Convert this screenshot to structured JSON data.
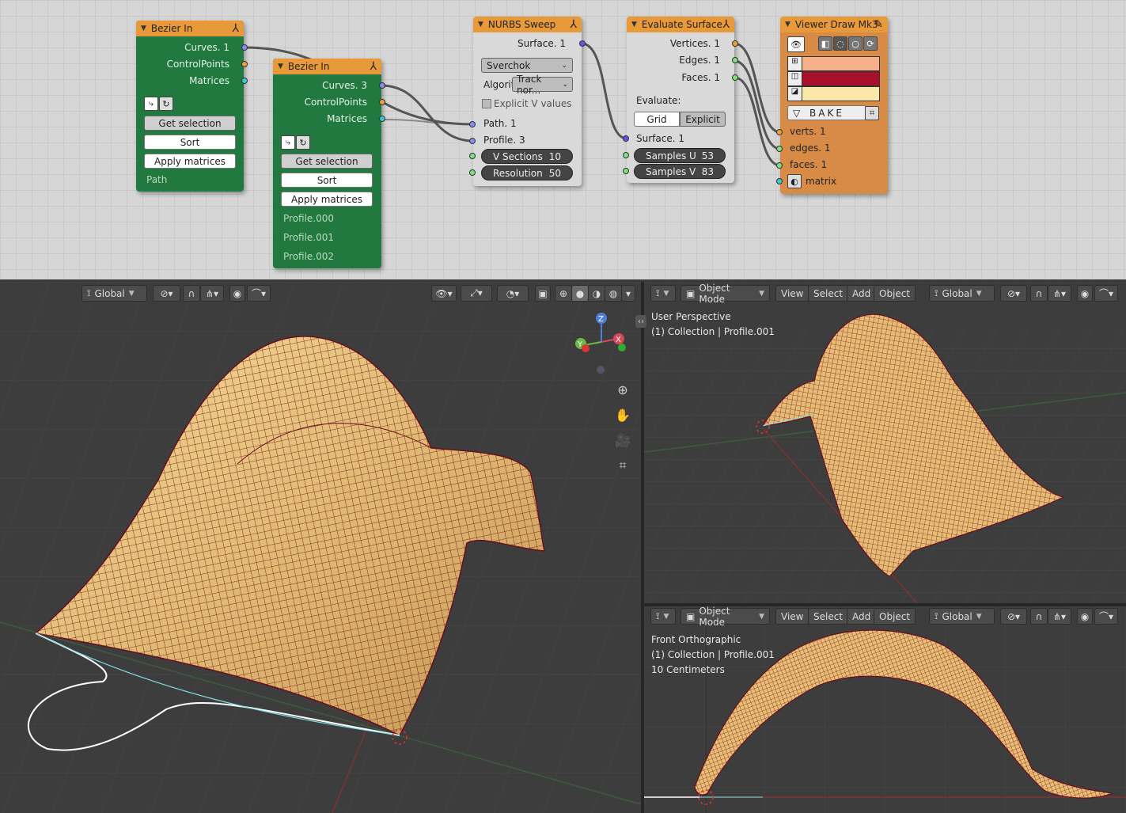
{
  "node_editor": {
    "bezier_in_1": {
      "title": "Bezier In",
      "outputs": [
        "Curves. 1",
        "ControlPoints",
        "Matrices"
      ],
      "get_selection": "Get selection",
      "sort": "Sort",
      "apply_matrices": "Apply matrices",
      "objects": [
        "Path"
      ]
    },
    "bezier_in_2": {
      "title": "Bezier In",
      "outputs": [
        "Curves. 3",
        "ControlPoints",
        "Matrices"
      ],
      "get_selection": "Get selection",
      "sort": "Sort",
      "apply_matrices": "Apply matrices",
      "objects": [
        "Profile.000",
        "Profile.001",
        "Profile.002"
      ]
    },
    "nurbs_sweep": {
      "title": "NURBS Sweep",
      "output": "Surface. 1",
      "implementation": "Sverchok",
      "algorithm_label": "Algorit",
      "algorithm_value": "Track nor...",
      "explicit_v": "Explicit V values",
      "inputs": [
        "Path. 1",
        "Profile. 3"
      ],
      "v_sections_label": "V Sections",
      "v_sections_value": "10",
      "resolution_label": "Resolution",
      "resolution_value": "50"
    },
    "evaluate_surface": {
      "title": "Evaluate Surface",
      "outputs": [
        "Vertices. 1",
        "Edges. 1",
        "Faces. 1"
      ],
      "evaluate_label": "Evaluate:",
      "mode_grid": "Grid",
      "mode_explicit": "Explicit",
      "input": "Surface. 1",
      "samples_u_label": "Samples U",
      "samples_u_value": "53",
      "samples_v_label": "Samples V",
      "samples_v_value": "83"
    },
    "viewer_draw": {
      "title": "Viewer Draw Mk3",
      "bake": "BAKE",
      "inputs": [
        "verts. 1",
        "edges. 1",
        "faces. 1",
        "matrix"
      ],
      "colors": {
        "verts": "#f6b08a",
        "edges": "#a8102c",
        "faces": "#fbe7a8"
      }
    }
  },
  "viewport_left": {
    "orientation": "Global"
  },
  "viewport_top_right": {
    "mode": "Object Mode",
    "menus": [
      "View",
      "Select",
      "Add",
      "Object"
    ],
    "orientation": "Global",
    "info_line1": "User Perspective",
    "info_line2": "(1) Collection | Profile.001"
  },
  "viewport_bottom_right": {
    "mode": "Object Mode",
    "menus": [
      "View",
      "Select",
      "Add",
      "Object"
    ],
    "orientation": "Global",
    "info_line1": "Front Orthographic",
    "info_line2": "(1) Collection | Profile.001",
    "info_line3": "10 Centimeters"
  },
  "gizmo": {
    "z": "Z",
    "y": "Y",
    "x": "X"
  },
  "colors": {
    "surface_fill": "#e8c27a",
    "surface_grid": "#7a1020",
    "node_green": "#22793f",
    "node_header": "#e89a3a",
    "viewer_body": "#d88b46"
  }
}
